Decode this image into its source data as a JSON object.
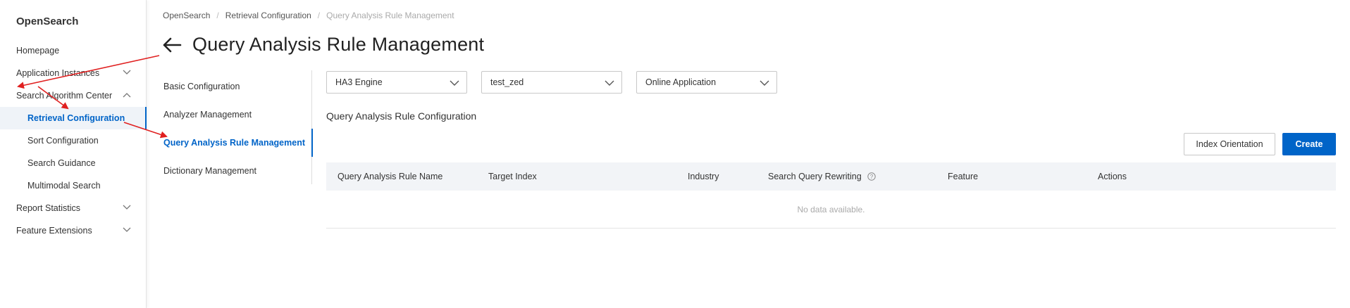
{
  "sidebar": {
    "brand": "OpenSearch",
    "items": [
      {
        "label": "Homepage"
      },
      {
        "label": "Application Instances"
      },
      {
        "label": "Search Algorithm Center"
      },
      {
        "label": "Retrieval Configuration"
      },
      {
        "label": "Sort Configuration"
      },
      {
        "label": "Search Guidance"
      },
      {
        "label": "Multimodal Search"
      },
      {
        "label": "Report Statistics"
      },
      {
        "label": "Feature Extensions"
      }
    ]
  },
  "breadcrumb": {
    "items": [
      "OpenSearch",
      "Retrieval Configuration",
      "Query Analysis Rule Management"
    ],
    "separator": "/"
  },
  "header": {
    "title": "Query Analysis Rule Management"
  },
  "secondary_nav": {
    "items": [
      {
        "label": "Basic Configuration"
      },
      {
        "label": "Analyzer Management"
      },
      {
        "label": "Query Analysis Rule Management"
      },
      {
        "label": "Dictionary Management"
      }
    ]
  },
  "filters": {
    "engine": "HA3 Engine",
    "instance": "test_zed",
    "app_type": "Online Application"
  },
  "section": {
    "title": "Query Analysis Rule Configuration"
  },
  "actions": {
    "index_orientation": "Index Orientation",
    "create": "Create"
  },
  "table": {
    "columns": [
      "Query Analysis Rule Name",
      "Target Index",
      "Industry",
      "Search Query Rewriting",
      "Feature",
      "Actions"
    ],
    "empty_text": "No data available."
  },
  "colors": {
    "primary": "#0064c8",
    "annotation": "#e02020"
  }
}
